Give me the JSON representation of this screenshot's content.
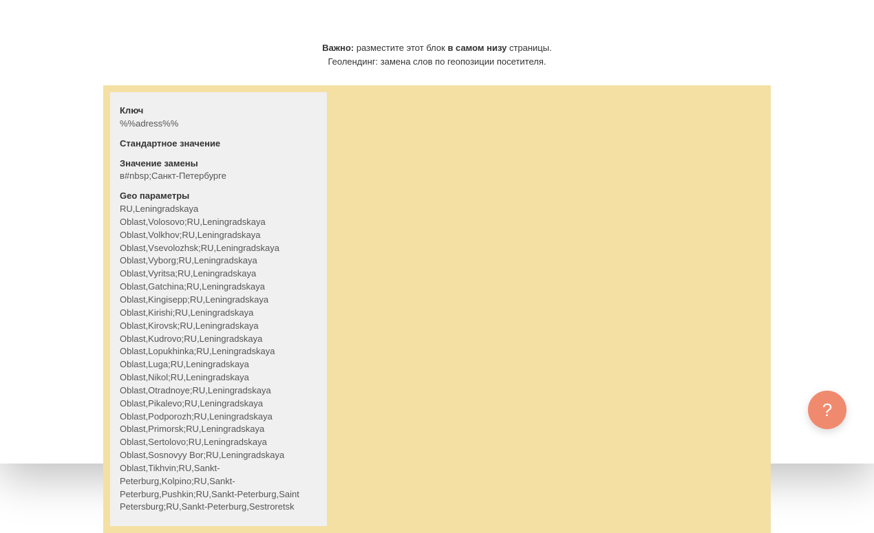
{
  "header": {
    "line1_prefix_bold": "Важно:",
    "line1_mid": " разместите этот блок ",
    "line1_bold2": "в самом низу",
    "line1_suffix": " страницы.",
    "line2": "Геолендинг: замена слов по геопозиции посетителя."
  },
  "panel": {
    "key_label": "Ключ",
    "key_value": "%%adress%%",
    "default_label": "Стандартное значение",
    "default_value": "",
    "replace_label": "Значение замены",
    "replace_value": "в#nbsp;Санкт-Петербурге",
    "geo_label": "Geo параметры",
    "geo_value": "RU,Leningradskaya Oblast,Volosovo;RU,Leningradskaya Oblast,Volkhov;RU,Leningradskaya Oblast,Vsevolozhsk;RU,Leningradskaya Oblast,Vyborg;RU,Leningradskaya Oblast,Vyritsa;RU,Leningradskaya Oblast,Gatchina;RU,Leningradskaya Oblast,Kingisepp;RU,Leningradskaya Oblast,Kirishi;RU,Leningradskaya Oblast,Kirovsk;RU,Leningradskaya Oblast,Kudrovo;RU,Leningradskaya Oblast,Lopukhinka;RU,Leningradskaya Oblast,Luga;RU,Leningradskaya Oblast,Nikol;RU,Leningradskaya Oblast,Otradnoye;RU,Leningradskaya Oblast,Pikalevo;RU,Leningradskaya Oblast,Podporozh;RU,Leningradskaya Oblast,Primorsk;RU,Leningradskaya Oblast,Sertolovo;RU,Leningradskaya Oblast,Sosnovyy Bor;RU,Leningradskaya Oblast,Tikhvin;RU,Sankt-Peterburg,Kolpino;RU,Sankt-Peterburg,Pushkin;RU,Sankt-Peterburg,Saint Petersburg;RU,Sankt-Peterburg,Sestroretsk"
  },
  "help_button": "?"
}
